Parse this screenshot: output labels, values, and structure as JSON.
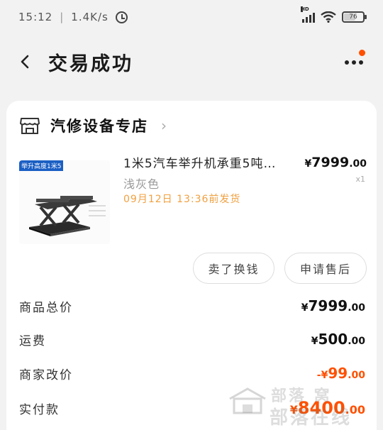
{
  "status_bar": {
    "time": "15:12",
    "network_speed": "1.4K/s",
    "battery_level": "76",
    "signal_tag": "HD"
  },
  "header": {
    "title": "交易成功"
  },
  "shop": {
    "name": "汽修设备专店"
  },
  "product": {
    "image_tag": "举升高度1米5",
    "title": "1米5汽车举升机承重5吨…",
    "variant": "浅灰色",
    "ship_note": "09月12日  13:36前发货",
    "price_currency": "¥",
    "price_int": "7999",
    "price_dec": ".00",
    "quantity": "x1"
  },
  "actions": {
    "resell_label": "卖了换钱",
    "aftersale_label": "申请售后"
  },
  "summary": {
    "goods_total_label": "商品总价",
    "goods_total_currency": "¥",
    "goods_total_int": "7999",
    "goods_total_dec": ".00",
    "shipping_label": "运费",
    "shipping_currency": "¥",
    "shipping_int": "500",
    "shipping_dec": ".00",
    "adjust_label": "商家改价",
    "adjust_currency": "-¥",
    "adjust_int": "99",
    "adjust_dec": ".00",
    "paid_label": "实付款",
    "paid_currency": "¥",
    "paid_int": "8400",
    "paid_dec": ".00"
  },
  "watermark": {
    "top": "部落 窝",
    "bottom": "部落在线"
  },
  "colors": {
    "accent": "#ff5000",
    "ship_note": "#f0a040",
    "background": "#f2f2f2"
  }
}
